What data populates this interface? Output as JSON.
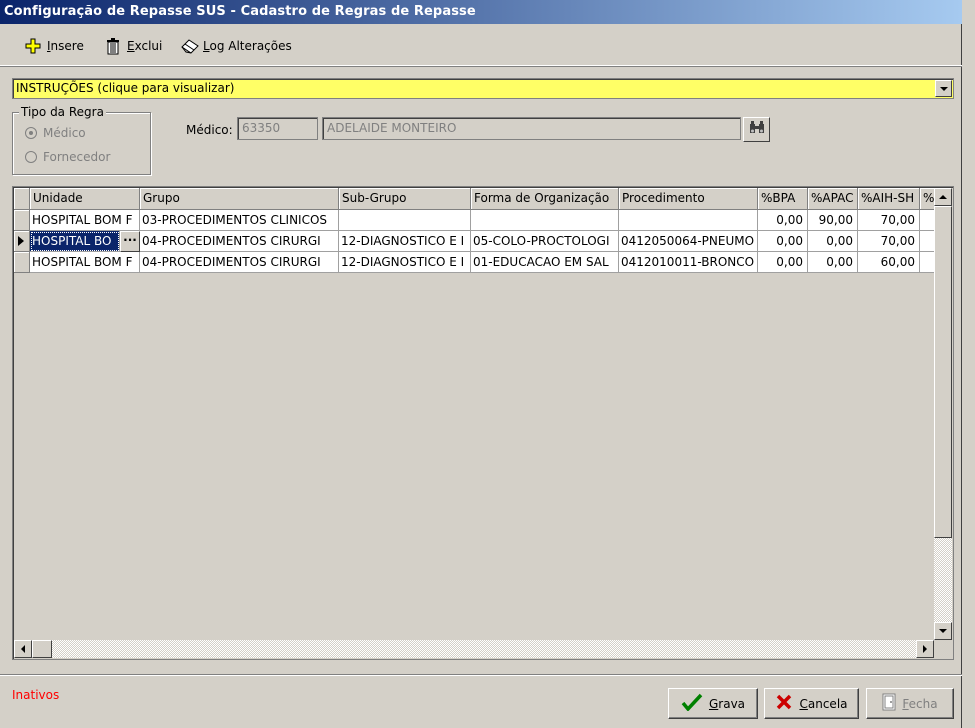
{
  "window": {
    "title": "Configuração de Repasse SUS - Cadastro de Regras de Repasse"
  },
  "toolbar": {
    "insere_accel": "I",
    "insere_rest": "nsere",
    "exclui_accel": "E",
    "exclui_rest": "xclui",
    "log_accel": "L",
    "log_rest": "og Alterações"
  },
  "instructions": {
    "text": "INSTRUÇÕES (clique para visualizar)"
  },
  "tipo_regra": {
    "legend": "Tipo da Regra",
    "options": [
      {
        "label": "Médico",
        "checked": true
      },
      {
        "label": "Fornecedor",
        "checked": false
      }
    ]
  },
  "medico": {
    "label": "Médico:",
    "code": "63350",
    "name": "ADELAIDE MONTEIRO"
  },
  "grid": {
    "columns": [
      "Unidade",
      "Grupo",
      "Sub-Grupo",
      "Forma de Organização",
      "Procedimento",
      "%BPA",
      "%APAC",
      "%AIH-SH",
      "%"
    ],
    "rows": [
      [
        "HOSPITAL BOM F",
        "03-PROCEDIMENTOS CLINICOS",
        "",
        "",
        "",
        "0,00",
        "90,00",
        "70,00",
        ""
      ],
      [
        "HOSPITAL BO",
        "04-PROCEDIMENTOS CIRURGI",
        "12-DIAGNOSTICO E I",
        "05-COLO-PROCTOLOGI",
        "0412050064-PNEUMO",
        "0,00",
        "0,00",
        "70,00",
        ""
      ],
      [
        "HOSPITAL BOM F",
        "04-PROCEDIMENTOS CIRURGI",
        "12-DIAGNOSTICO E I",
        "01-EDUCACAO EM SAL",
        "0412010011-BRONCO",
        "0,00",
        "0,00",
        "60,00",
        ""
      ]
    ],
    "selected_row": 1,
    "ellipsis": "···"
  },
  "footer": {
    "status": "Inativos",
    "grava_accel": "G",
    "grava_rest": "rava",
    "cancela_accel": "C",
    "cancela_rest": "ancela",
    "fecha_accel": "F",
    "fecha_rest": "echa"
  }
}
